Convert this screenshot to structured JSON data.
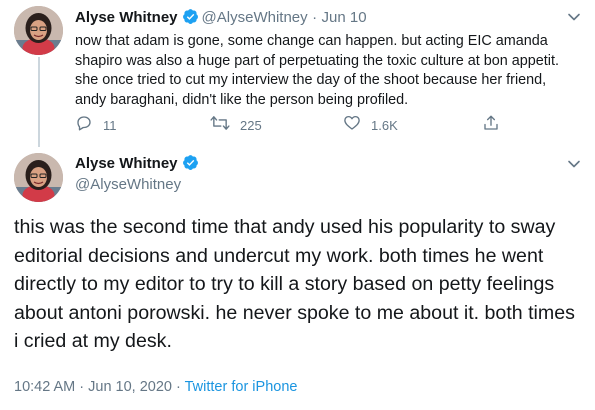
{
  "tweet1": {
    "name": "Alyse Whitney",
    "handle": "@AlyseWhitney",
    "separator": "·",
    "date": "Jun 10",
    "text": "now that adam is gone, some change can happen. but acting EIC amanda shapiro was also a huge part of perpetuating the toxic culture at bon appetit. she once tried to cut my interview the day of the shoot because her friend, andy baraghani, didn't like the person being profiled.",
    "replies": "11",
    "retweets": "225",
    "likes": "1.6K"
  },
  "tweet2": {
    "name": "Alyse Whitney",
    "handle": "@AlyseWhitney",
    "text": "this was the second time that andy used his popularity to sway editorial decisions and undercut my work. both times he went directly to my editor to try to kill a story based on petty feelings about antoni porowski. he never spoke to me about it. both times i cried at my desk.",
    "timestamp": "10:42 AM · Jun 10, 2020",
    "meta_separator": " · ",
    "source": "Twitter for iPhone"
  },
  "icons": [
    "verified-badge-icon",
    "chevron-down-icon",
    "reply-icon",
    "retweet-icon",
    "like-icon",
    "share-icon"
  ],
  "colors": {
    "text": "#14171a",
    "secondary": "#657786",
    "link": "#1b95e0",
    "verified": "#1da1f2",
    "thread_line": "#ccd6dd"
  }
}
